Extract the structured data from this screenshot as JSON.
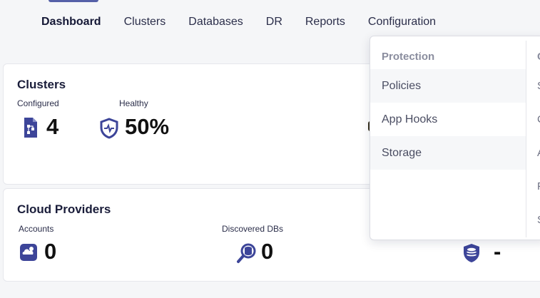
{
  "nav": {
    "items": [
      {
        "label": "Dashboard",
        "active": true
      },
      {
        "label": "Clusters",
        "active": false
      },
      {
        "label": "Databases",
        "active": false
      },
      {
        "label": "DR",
        "active": false
      },
      {
        "label": "Reports",
        "active": false
      },
      {
        "label": "Configuration",
        "active": false
      }
    ]
  },
  "clusters_card": {
    "title": "Clusters",
    "configured": {
      "label": "Configured",
      "value": "4",
      "icon": "cluster-document-icon"
    },
    "healthy": {
      "label": "Healthy",
      "value": "50%",
      "icon": "shield-heartbeat-icon"
    }
  },
  "cloud_card": {
    "title": "Cloud Providers",
    "accounts": {
      "label": "Accounts",
      "value": "0",
      "icon": "cloud-account-icon"
    },
    "discovered": {
      "label": "Discovered DBs",
      "value": "0",
      "icon": "database-search-icon"
    },
    "protected": {
      "value": "-",
      "icon": "database-shield-icon"
    }
  },
  "config_menu": {
    "section_heading": "Protection",
    "items": [
      "Policies",
      "App Hooks",
      "Storage"
    ],
    "second_column": {
      "heading": "C",
      "items": [
        "S",
        "C",
        "A",
        "F",
        "S"
      ]
    }
  },
  "colors": {
    "accent": "#3d4599",
    "heading_muted": "#8a8d9e",
    "menu_hover": "#f6f7f9"
  }
}
